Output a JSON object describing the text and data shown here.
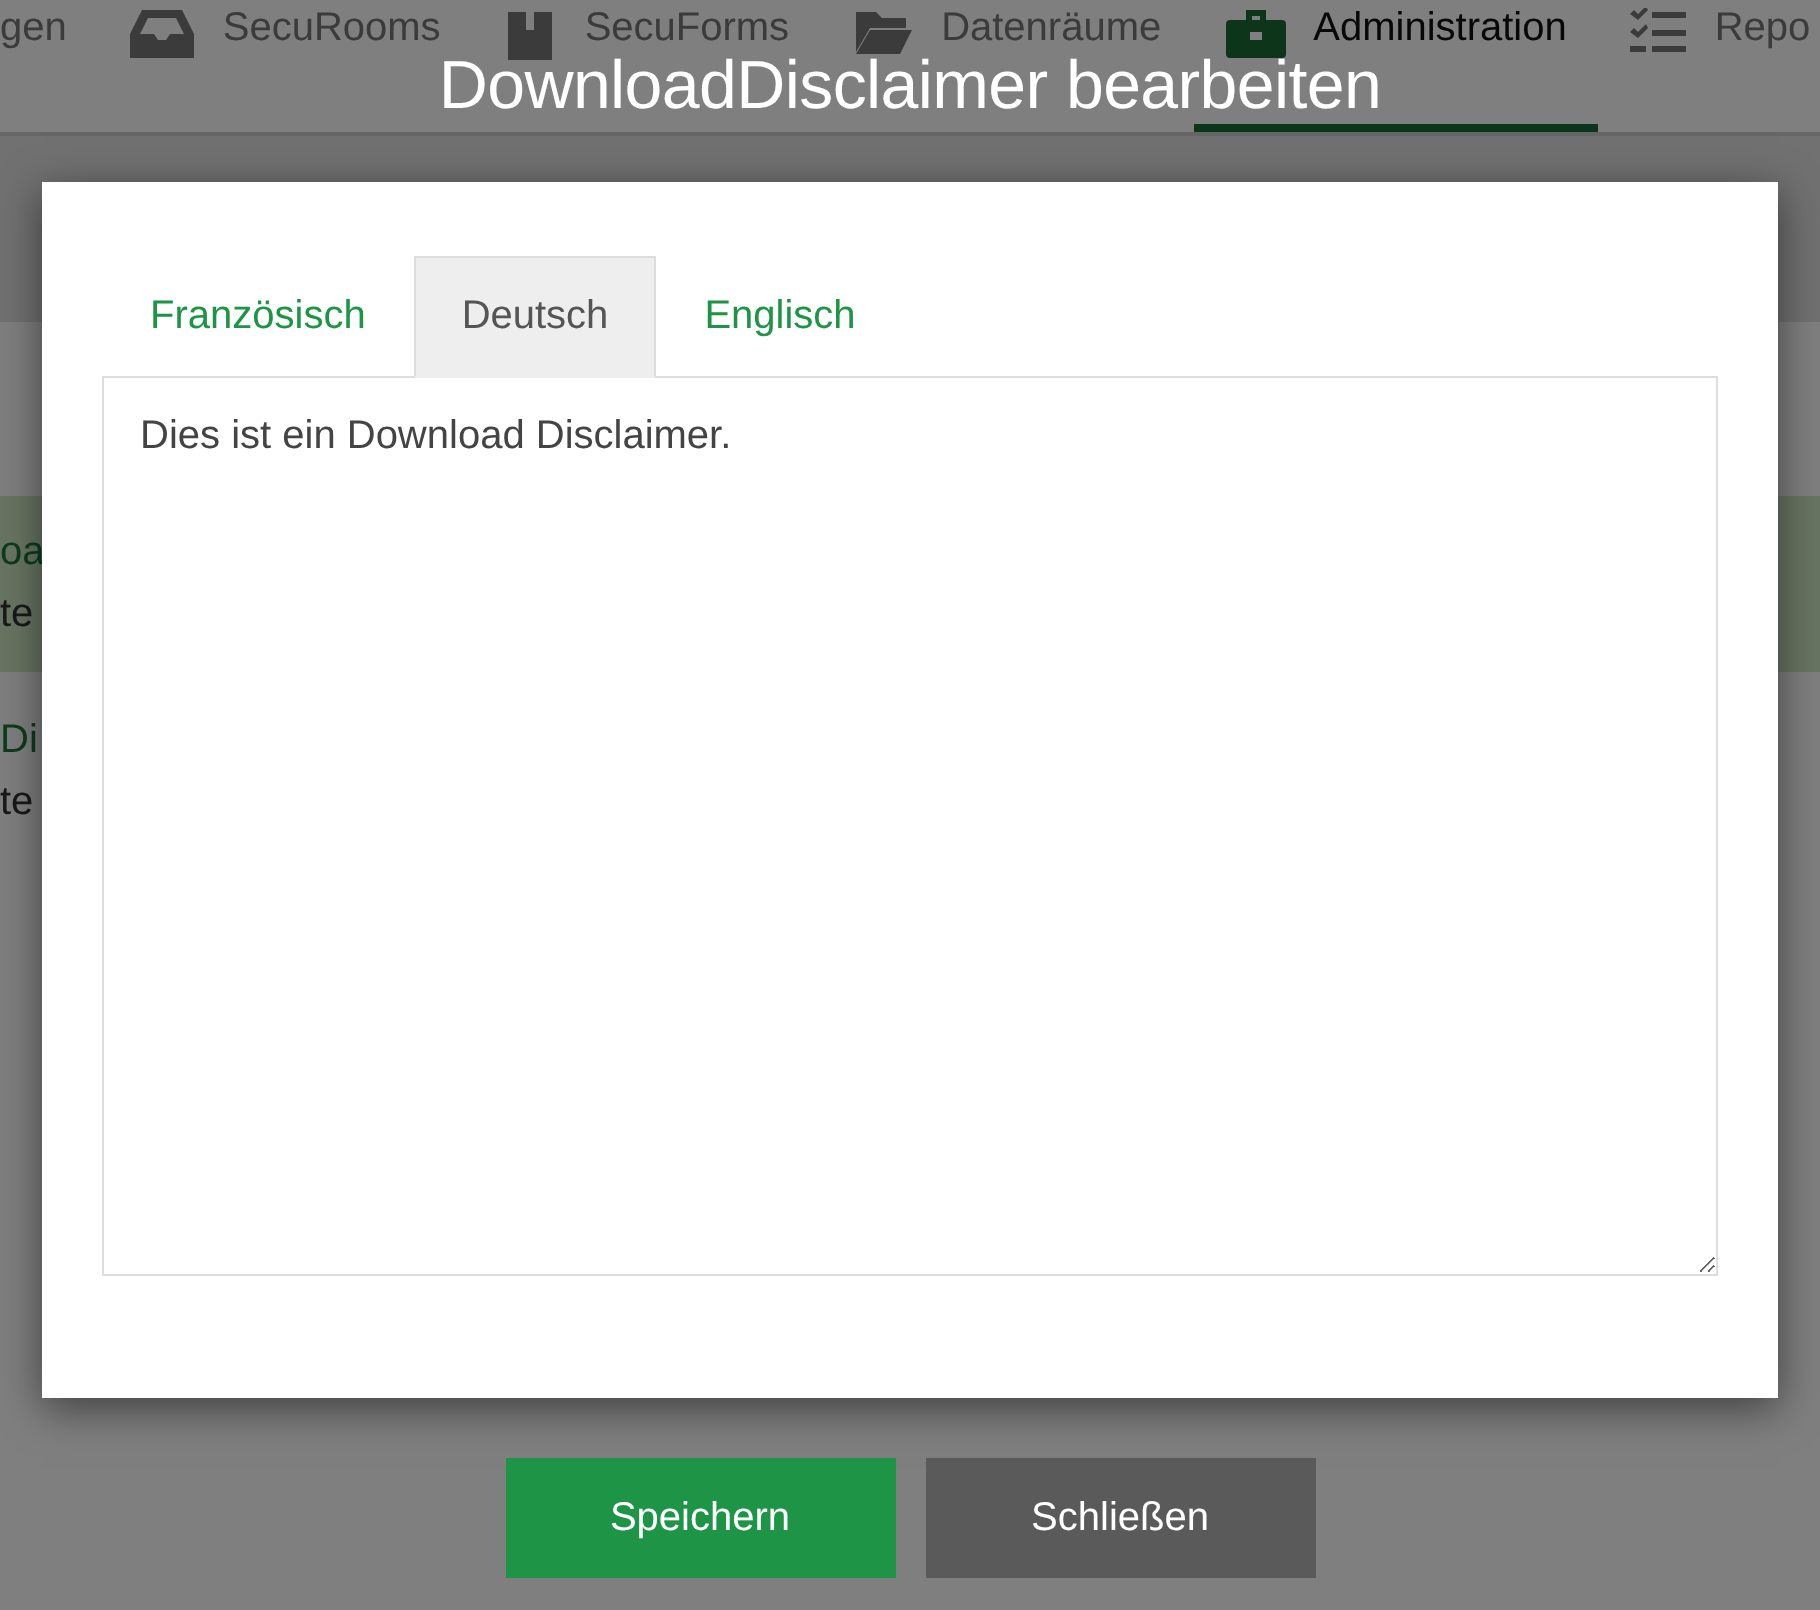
{
  "nav": {
    "items": [
      {
        "label": "gen",
        "selected": false
      },
      {
        "label": "SecuRooms",
        "kind": "inbox",
        "selected": false
      },
      {
        "label": "SecuForms",
        "kind": "box",
        "selected": false
      },
      {
        "label": "Datenräume",
        "kind": "folder",
        "selected": false
      },
      {
        "label": "Administration",
        "kind": "briefcase",
        "selected": true
      },
      {
        "label": "Repo",
        "kind": "checklist",
        "selected": false
      }
    ]
  },
  "background_list": [
    {
      "title": "oa",
      "subtitle": "te",
      "highlighted": true
    },
    {
      "title": "Di",
      "subtitle": "te",
      "highlighted": false
    }
  ],
  "dialog": {
    "title": "DownloadDisclaimer bearbeiten",
    "tabs": [
      {
        "label": "Französisch",
        "selected": false
      },
      {
        "label": "Deutsch",
        "selected": true
      },
      {
        "label": "Englisch",
        "selected": false
      }
    ],
    "text": "Dies ist ein Download Disclaimer.",
    "buttons": [
      {
        "label": "Speichern",
        "kind": "primary"
      },
      {
        "label": "Schließen",
        "kind": "secondary"
      }
    ]
  }
}
